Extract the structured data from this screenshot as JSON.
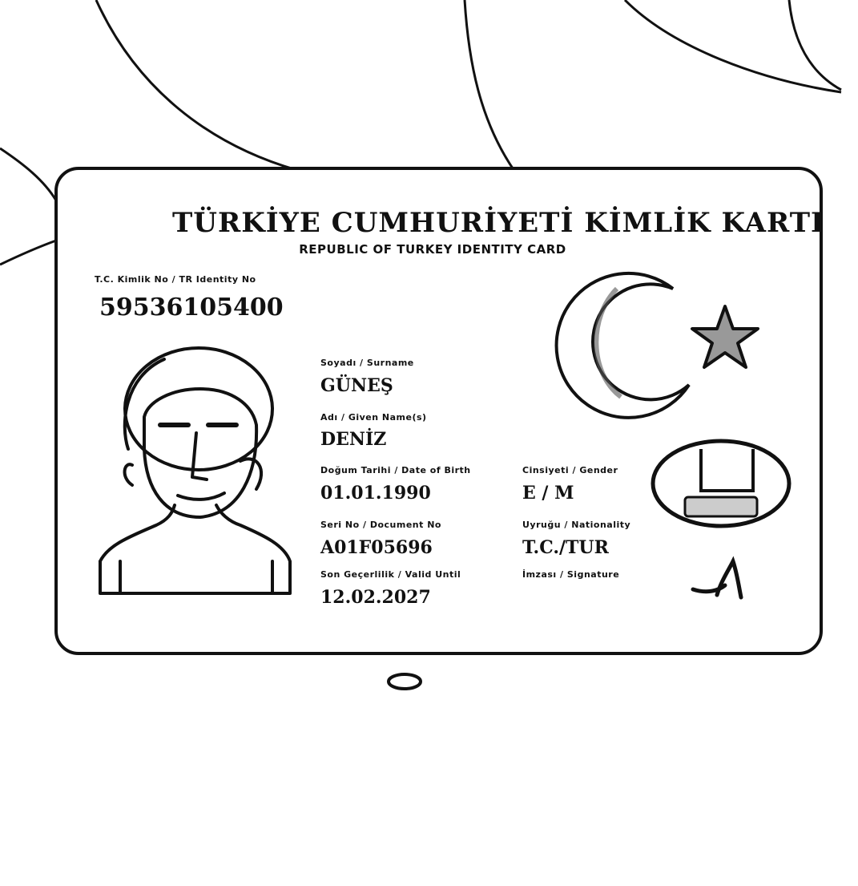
{
  "card": {
    "title": "TÜRKİYE CUMHURİYETİ KİMLİK KARTI",
    "subtitle": "REPUBLIC OF TURKEY IDENTITY CARD",
    "id_label": "T.C. Kimlik No / TR Identity No",
    "id_number": "59536105400",
    "fields": {
      "surname": {
        "label": "Soyadı / Surname",
        "value": "GÜNEŞ"
      },
      "given_names": {
        "label": "Adı / Given Name(s)",
        "value": "DENİZ"
      },
      "birth_date": {
        "label": "Doğum Tarihi / Date of Birth",
        "value": "01.01.1990"
      },
      "gender": {
        "label": "Cinsiyeti / Gender",
        "value": "E / M"
      },
      "serial_no": {
        "label": "Seri No / Document No",
        "value": "A01F05696"
      },
      "nationality": {
        "label": "Uyruğu / Nationality",
        "value": "T.C./TUR"
      },
      "valid_until": {
        "label": "Son Geçerlilik / Valid Until",
        "value": "12.02.2027"
      },
      "signature_label": {
        "label": "İmzası / Signature"
      }
    }
  },
  "colors": {
    "ink": "#111111",
    "paper": "#ffffff"
  }
}
